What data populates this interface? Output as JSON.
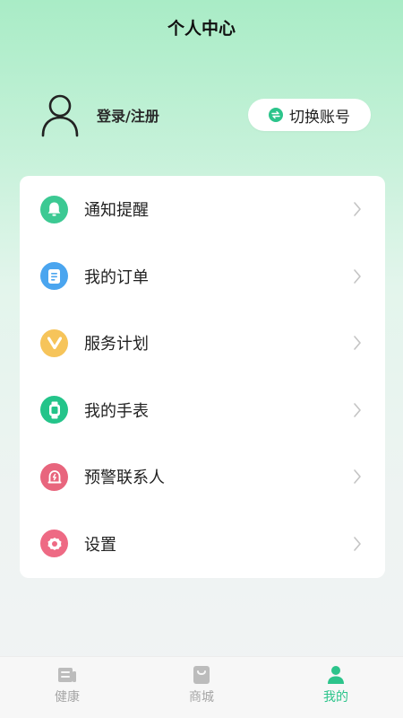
{
  "header": {
    "title": "个人中心"
  },
  "profile": {
    "login_label": "登录/注册",
    "switch_account_label": "切换账号"
  },
  "menu": {
    "items": [
      {
        "label": "通知提醒",
        "icon": "bell-icon",
        "color": "#3cc993"
      },
      {
        "label": "我的订单",
        "icon": "document-icon",
        "color": "#4aa5ef"
      },
      {
        "label": "服务计划",
        "icon": "v-badge-icon",
        "color": "#f6c45a"
      },
      {
        "label": "我的手表",
        "icon": "watch-icon",
        "color": "#24c48a"
      },
      {
        "label": "预警联系人",
        "icon": "alert-icon",
        "color": "#e8657d"
      },
      {
        "label": "设置",
        "icon": "gear-icon",
        "color": "#ee6a84"
      }
    ]
  },
  "tabbar": {
    "tabs": [
      {
        "label": "健康",
        "icon": "news-icon"
      },
      {
        "label": "商城",
        "icon": "shopping-bag-icon"
      },
      {
        "label": "我的",
        "icon": "person-icon",
        "active": true
      }
    ],
    "active_color": "#2cc48b"
  }
}
